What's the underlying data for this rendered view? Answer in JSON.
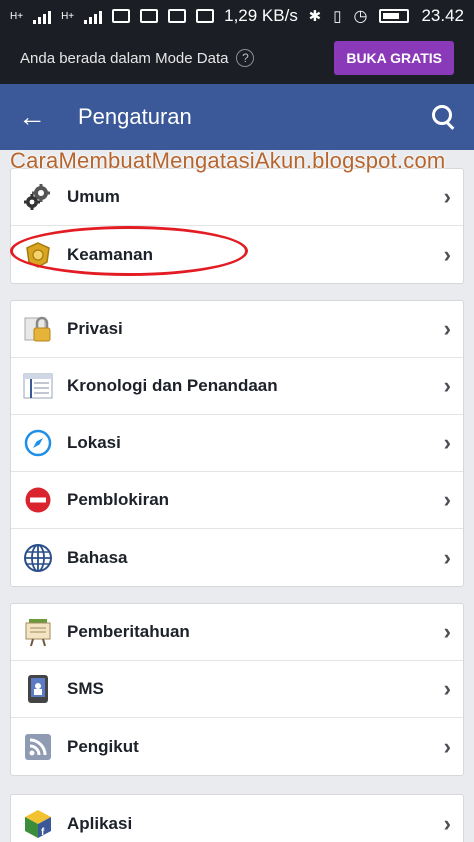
{
  "status_bar": {
    "network_1": "H+",
    "network_2": "H+",
    "speed": "1,29 KB/s",
    "time": "23.42"
  },
  "data_mode_bar": {
    "text": "Anda berada dalam Mode Data",
    "help_symbol": "?",
    "button_label": "BUKA GRATIS"
  },
  "app_bar": {
    "title": "Pengaturan",
    "back_symbol": "←"
  },
  "watermark": "CaraMembuatMengatasiAkun.blogspot.com",
  "groups": [
    {
      "items": [
        {
          "label": "Umum",
          "icon": "gears-icon"
        },
        {
          "label": "Keamanan",
          "icon": "badge-icon"
        }
      ]
    },
    {
      "items": [
        {
          "label": "Privasi",
          "icon": "lock-icon"
        },
        {
          "label": "Kronologi dan Penandaan",
          "icon": "timeline-icon"
        },
        {
          "label": "Lokasi",
          "icon": "compass-icon"
        },
        {
          "label": "Pemblokiran",
          "icon": "block-icon"
        },
        {
          "label": "Bahasa",
          "icon": "globe-icon"
        }
      ]
    },
    {
      "items": [
        {
          "label": "Pemberitahuan",
          "icon": "notice-board-icon"
        },
        {
          "label": "SMS",
          "icon": "phone-icon"
        },
        {
          "label": "Pengikut",
          "icon": "rss-icon"
        }
      ]
    },
    {
      "items": [
        {
          "label": "Aplikasi",
          "icon": "app-cube-icon"
        }
      ]
    }
  ],
  "chevron": "›",
  "colors": {
    "app_bar": "#3b5998",
    "status_bar": "#1b1e24",
    "buka_button": "#8a3ab9",
    "highlight": "#e31b23"
  }
}
